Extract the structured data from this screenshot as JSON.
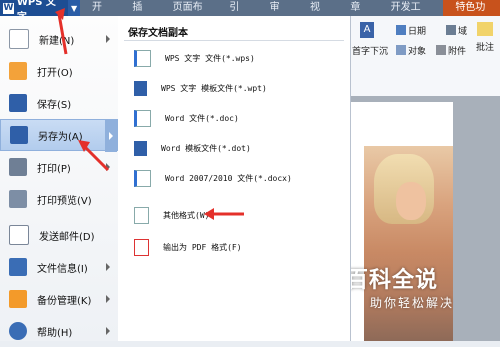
{
  "app": {
    "title": "WPS 文字",
    "logo_text": "W"
  },
  "tabs": [
    "开始",
    "插入",
    "页面布局",
    "引用",
    "审阅",
    "视图",
    "章节",
    "开发工具",
    "特色功能"
  ],
  "ribbon": {
    "date_label": "日期",
    "field_label": "域",
    "object_label": "对象",
    "attach_label": "附件",
    "sink_label": "首字下沉",
    "comment_label": "批注"
  },
  "left_menu": {
    "items": [
      {
        "label": "新建(N)",
        "icon": "new-icon",
        "has_arrow": true
      },
      {
        "label": "打开(O)",
        "icon": "open-icon",
        "has_arrow": false
      },
      {
        "label": "保存(S)",
        "icon": "save-icon",
        "has_arrow": false
      },
      {
        "label": "另存为(A)",
        "icon": "save-as-icon",
        "has_arrow": true
      },
      {
        "label": "打印(P)",
        "icon": "print-icon",
        "has_arrow": true
      },
      {
        "label": "打印预览(V)",
        "icon": "print-preview-icon",
        "has_arrow": false
      },
      {
        "label": "发送邮件(D)",
        "icon": "mail-icon",
        "has_arrow": false
      },
      {
        "label": "文件信息(I)",
        "icon": "file-info-icon",
        "has_arrow": true
      },
      {
        "label": "备份管理(K)",
        "icon": "backup-icon",
        "has_arrow": true
      },
      {
        "label": "帮助(H)",
        "icon": "help-icon",
        "has_arrow": true
      }
    ]
  },
  "submenu": {
    "title": "保存文档副本",
    "items": [
      {
        "label": "WPS 文字 文件(*.wps)",
        "icon": "wps-file-icon"
      },
      {
        "label": "WPS 文字 模板文件(*.wpt)",
        "icon": "wps-template-icon"
      },
      {
        "label": "Word 文件(*.doc)",
        "icon": "word-file-icon"
      },
      {
        "label": "Word 模板文件(*.dot)",
        "icon": "word-template-icon"
      },
      {
        "label": "Word 2007/2010 文件(*.docx)",
        "icon": "docx-file-icon"
      },
      {
        "label": "其他格式(W)",
        "icon": "other-format-icon"
      },
      {
        "label": "输出为 PDF 格式(F)",
        "icon": "pdf-icon"
      }
    ]
  },
  "watermark": {
    "title": "百科全说",
    "subtitle": "助你轻松解决"
  },
  "colors": {
    "accent": "#1d4d93",
    "annotation": "#e4302a",
    "special_tab": "#c8521c"
  }
}
